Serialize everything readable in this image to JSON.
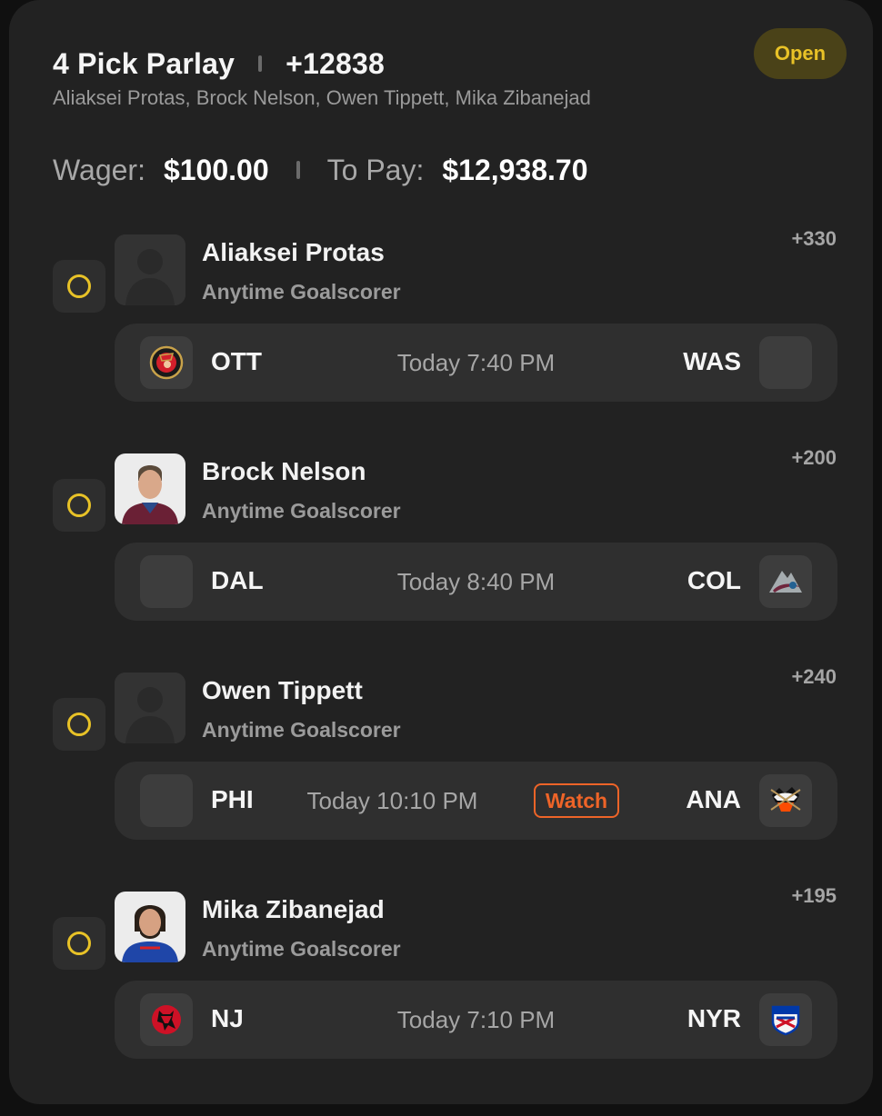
{
  "bet": {
    "title": "4 Pick Parlay",
    "odds": "+12838",
    "players_line": "Aliaksei Protas, Brock Nelson, Owen Tippett, Mika Zibanejad",
    "status": "Open",
    "wager_label": "Wager:",
    "wager_value": "$100.00",
    "topay_label": "To Pay:",
    "topay_value": "$12,938.70"
  },
  "legs": [
    {
      "player": "Aliaksei Protas",
      "market": "Anytime Goalscorer",
      "odds": "+330",
      "avatar": "placeholder-silhouette",
      "away_team": "OTT",
      "away_logo": "senators-logo",
      "game_time": "Today 7:40 PM",
      "home_team": "WAS",
      "home_logo": "blank-logo"
    },
    {
      "player": "Brock Nelson",
      "market": "Anytime Goalscorer",
      "odds": "+200",
      "avatar": "player-headshot",
      "away_team": "DAL",
      "away_logo": "blank-logo",
      "game_time": "Today 8:40 PM",
      "home_team": "COL",
      "home_logo": "avalanche-logo"
    },
    {
      "player": "Owen Tippett",
      "market": "Anytime Goalscorer",
      "odds": "+240",
      "avatar": "placeholder-silhouette",
      "away_team": "PHI",
      "away_logo": "blank-logo",
      "game_time": "Today 10:10 PM",
      "watch_label": "Watch",
      "home_team": "ANA",
      "home_logo": "ducks-logo"
    },
    {
      "player": "Mika Zibanejad",
      "market": "Anytime Goalscorer",
      "odds": "+195",
      "avatar": "player-headshot",
      "away_team": "NJ",
      "away_logo": "devils-logo",
      "game_time": "Today 7:10 PM",
      "home_team": "NYR",
      "home_logo": "rangers-logo"
    }
  ],
  "colors": {
    "accent_yellow": "#e8c227",
    "watch_orange": "#ee6428",
    "card_bg": "#222222",
    "panel_bg": "#2f2f2f"
  }
}
